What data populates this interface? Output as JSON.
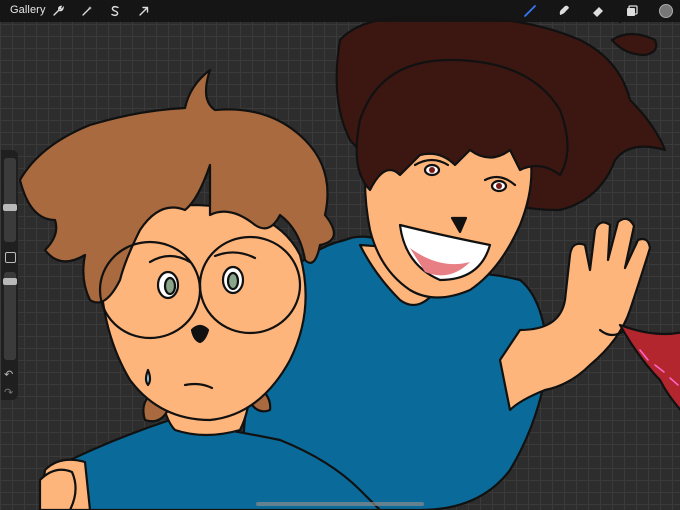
{
  "topbar": {
    "gallery_label": "Gallery",
    "left_tools": [
      {
        "name": "actions",
        "icon": "wrench-icon"
      },
      {
        "name": "adjustments",
        "icon": "magic-wand-icon"
      },
      {
        "name": "selection",
        "icon": "selection-s-icon"
      },
      {
        "name": "transform",
        "icon": "arrow-cursor-icon"
      }
    ],
    "right_tools": [
      {
        "name": "brush",
        "icon": "brush-icon",
        "active": true
      },
      {
        "name": "smudge",
        "icon": "smudge-icon"
      },
      {
        "name": "eraser",
        "icon": "eraser-icon"
      },
      {
        "name": "layers",
        "icon": "layers-icon"
      },
      {
        "name": "color",
        "icon": "color-swatch-icon"
      }
    ]
  },
  "sidebar": {
    "brush_size": 0.6,
    "opacity": 1.0,
    "undo_icon": "undo-icon",
    "redo_icon": "redo-icon"
  },
  "colors": {
    "accent": "#3478f6",
    "skin": "#fdb57c",
    "shirt": "#0a6b9a",
    "hair_light": "#a86a3e",
    "hair_dark": "#3c1712",
    "background": "#2d2d2d"
  }
}
